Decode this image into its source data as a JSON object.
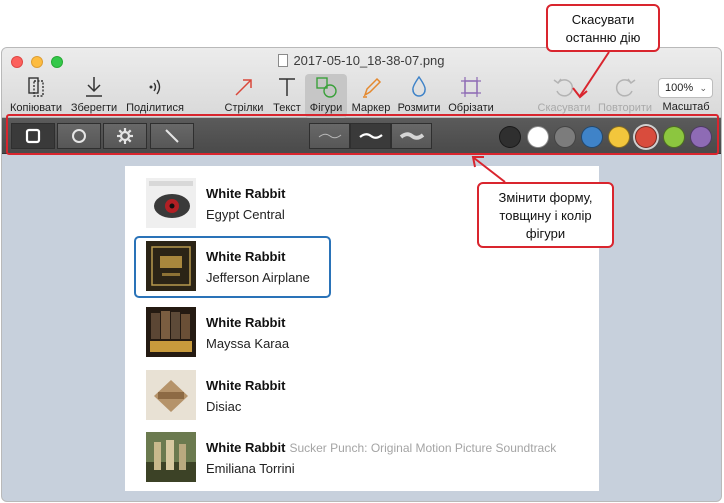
{
  "window": {
    "filename": "2017-05-10_18-38-07.png"
  },
  "toolbar": {
    "copy_label": "Копіювати",
    "save_label": "Зберегти",
    "share_label": "Поділитися",
    "arrows_label": "Стрілки",
    "text_label": "Текст",
    "shapes_label": "Фігури",
    "marker_label": "Маркер",
    "blur_label": "Розмити",
    "crop_label": "Обрізати",
    "undo_label": "Скасувати",
    "redo_label": "Повторити",
    "zoom_label": "Масштаб",
    "zoom_value": "100%"
  },
  "shape_bar": {
    "shapes": [
      "rectangle",
      "circle",
      "gear",
      "line"
    ],
    "selected_shape": "rectangle",
    "stroke_widths": [
      "thin",
      "medium",
      "thick"
    ],
    "selected_stroke": "medium",
    "colors": [
      "#2f2f2f",
      "#ffffff",
      "#7c7c7c",
      "#3f83c8",
      "#f2c63c",
      "#d94c3d",
      "#8cc63f",
      "#8e6bb5"
    ],
    "selected_color": "#d94c3d"
  },
  "callouts": {
    "undo_hint": "Скасувати останню дію",
    "shape_hint": "Змінити форму, товщину і колір фігури"
  },
  "tracks": [
    {
      "title": "White Rabbit",
      "album": "",
      "artist": "Egypt Central"
    },
    {
      "title": "White Rabbit",
      "album": "",
      "artist": "Jefferson Airplane"
    },
    {
      "title": "White Rabbit",
      "album": "",
      "artist": "Mayssa Karaa"
    },
    {
      "title": "White Rabbit",
      "album": "",
      "artist": "Disiac"
    },
    {
      "title": "White Rabbit",
      "album": "Sucker Punch: Original Motion Picture Soundtrack",
      "artist": "Emiliana Torrini"
    }
  ]
}
